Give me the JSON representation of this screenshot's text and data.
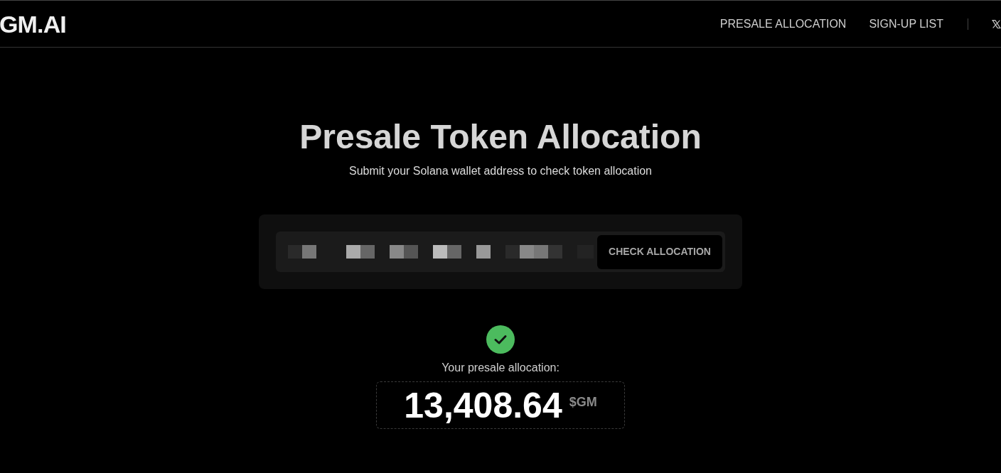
{
  "header": {
    "logo": "GM.AI",
    "nav": [
      {
        "label": "PRESALE ALLOCATION"
      },
      {
        "label": "SIGN-UP LIST"
      }
    ]
  },
  "hero": {
    "title": "Presale Token Allocation",
    "subtitle": "Submit your Solana wallet address to check token allocation"
  },
  "form": {
    "button": "CHECK ALLOCATION"
  },
  "result": {
    "success": true,
    "label": "Your presale allocation:",
    "amount": "13,408.64",
    "unit": "$GM"
  }
}
